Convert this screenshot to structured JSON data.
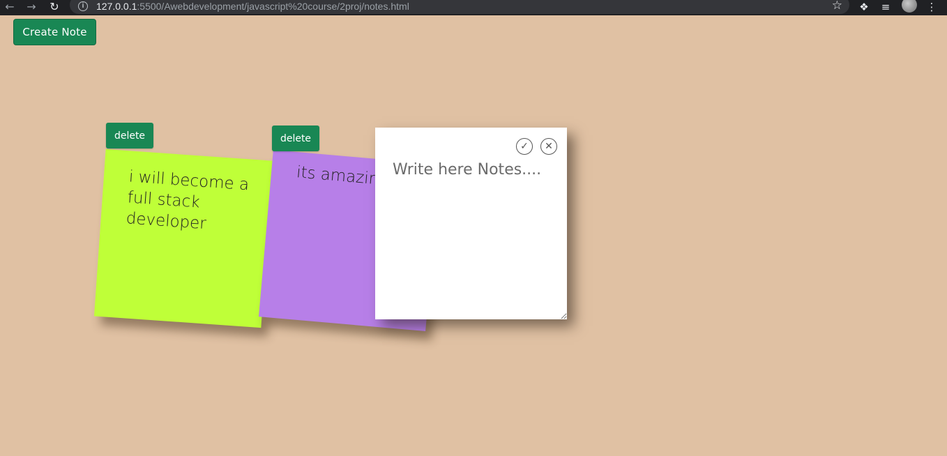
{
  "browser": {
    "url_host": "127.0.0.1",
    "url_path": ":5500/Awebdevelopment/javascript%20course/2proj/notes.html"
  },
  "toolbar": {
    "create_label": "Create Note"
  },
  "notes": [
    {
      "text": "i will become a full stack developer",
      "delete_label": "delete",
      "color": "#bfff38"
    },
    {
      "text": "its amazing",
      "delete_label": "delete",
      "color": "#b77fe8"
    }
  ],
  "editor": {
    "placeholder": "Write here Notes...."
  },
  "colors": {
    "background": "#e0c1a3",
    "accent": "#198754"
  }
}
